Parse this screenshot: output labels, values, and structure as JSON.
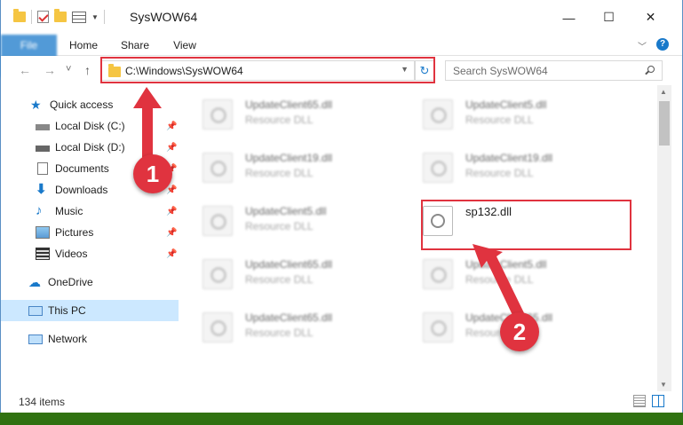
{
  "window": {
    "title": "SysWOW64",
    "minimize": "—",
    "maximize": "☐",
    "close": "✕"
  },
  "ribbon": {
    "tabs": [
      "File",
      "Home",
      "Share",
      "View"
    ]
  },
  "nav": {
    "back": "←",
    "forward": "→",
    "recent": "˅",
    "up": "↑"
  },
  "address": {
    "path": "C:\\Windows\\SysWOW64"
  },
  "search": {
    "placeholder": "Search SysWOW64"
  },
  "sidebar": {
    "items": [
      {
        "label": "Quick access"
      },
      {
        "label": "Local Disk (C:)"
      },
      {
        "label": "Local Disk (D:)"
      },
      {
        "label": "Documents"
      },
      {
        "label": "Downloads"
      },
      {
        "label": "Music"
      },
      {
        "label": "Pictures"
      },
      {
        "label": "Videos"
      },
      {
        "label": "OneDrive"
      },
      {
        "label": "This PC"
      },
      {
        "label": "Network"
      }
    ]
  },
  "files": [
    {
      "name": "UpdateClient65.dll",
      "type": "Resource DLL"
    },
    {
      "name": "UpdateClient5.dll",
      "type": "Resource DLL"
    },
    {
      "name": "UpdateClient19.dll",
      "type": "Resource DLL"
    },
    {
      "name": "UpdateClient19.dll",
      "type": "Resource DLL"
    },
    {
      "name": "UpdateClient5.dll",
      "type": "Resource DLL"
    },
    {
      "name": "sp132.dll",
      "type": ""
    },
    {
      "name": "UpdateClient65.dll",
      "type": "Resource DLL"
    },
    {
      "name": "UpdateClient5.dll",
      "type": "Resource DLL"
    },
    {
      "name": "UpdateClient65.dll",
      "type": "Resource DLL"
    },
    {
      "name": "UpdateClient65.dll",
      "type": "Resource DLL"
    }
  ],
  "status": {
    "count": "134 items"
  },
  "annotations": {
    "step1": "1",
    "step2": "2",
    "color": "#e0333f"
  }
}
